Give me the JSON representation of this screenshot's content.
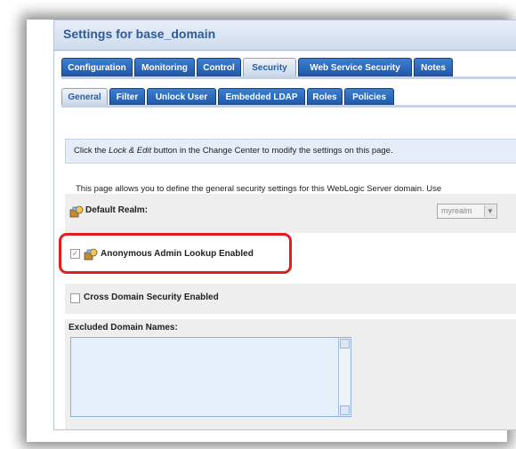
{
  "window": {
    "title": "Settings for base_domain"
  },
  "tabs_primary": [
    {
      "label": "Configuration",
      "active": false
    },
    {
      "label": "Monitoring",
      "active": false
    },
    {
      "label": "Control",
      "active": false
    },
    {
      "label": "Security",
      "active": true
    },
    {
      "label": "Web Service Security",
      "active": false
    },
    {
      "label": "Notes",
      "active": false
    }
  ],
  "tabs_secondary": [
    {
      "label": "General",
      "active": true
    },
    {
      "label": "Filter",
      "active": false
    },
    {
      "label": "Unlock User",
      "active": false
    },
    {
      "label": "Embedded LDAP",
      "active": false
    },
    {
      "label": "Roles",
      "active": false
    },
    {
      "label": "Policies",
      "active": false
    }
  ],
  "info": {
    "prefix": "Click the ",
    "emphasis": "Lock & Edit",
    "suffix": " button in the Change Center to modify the settings on this page."
  },
  "description": "This page allows you to define the general security settings for this WebLogic Server domain. Use",
  "fields": {
    "default_realm": {
      "label": "Default Realm:",
      "value": "myrealm",
      "icon": "realm-icon"
    },
    "anonymous_admin_lookup": {
      "label": "Anonymous Admin Lookup Enabled",
      "checked": true,
      "icon": "realm-icon"
    },
    "cross_domain_security": {
      "label": "Cross Domain Security Enabled",
      "checked": false
    },
    "excluded_domain_names": {
      "label": "Excluded Domain Names:",
      "value": ""
    }
  },
  "colors": {
    "tab_blue": "#1c54a6",
    "highlight_red": "#e02020",
    "title_text": "#2f5b98"
  }
}
